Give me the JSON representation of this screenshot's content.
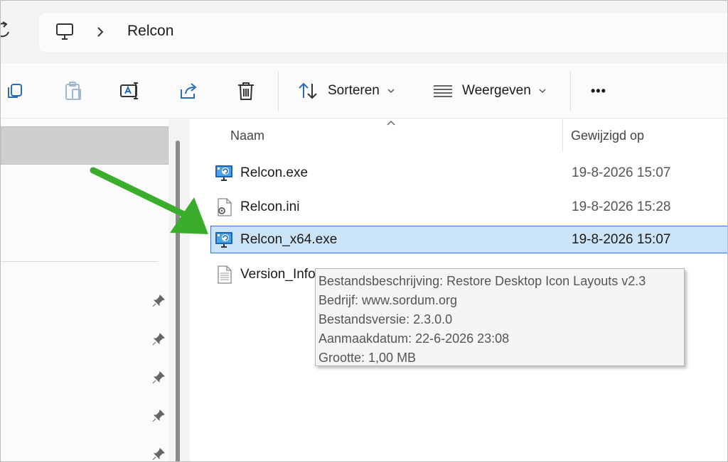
{
  "address_bar": {
    "breadcrumb": "Relcon",
    "icons": [
      "refresh-icon",
      "computer-icon",
      "chevron-right-icon"
    ]
  },
  "command_bar": {
    "sort_label": "Sorteren",
    "view_label": "Weergeven",
    "more_label": "•••",
    "icons": [
      "copy-icon",
      "paste-icon",
      "rename-icon",
      "share-icon",
      "delete-icon",
      "sort-icon",
      "view-icon",
      "chevron-down-icon"
    ]
  },
  "columns": {
    "name": "Naam",
    "modified": "Gewijzigd op"
  },
  "files": [
    {
      "name": "Relcon.exe",
      "modified": "19-8-2026 15:07",
      "icon": "application-icon",
      "selected": false
    },
    {
      "name": "Relcon.ini",
      "modified": "19-8-2026 15:28",
      "icon": "settings-file-icon",
      "selected": false
    },
    {
      "name": "Relcon_x64.exe",
      "modified": "19-8-2026 15:07",
      "icon": "application-icon",
      "selected": true
    },
    {
      "name": "Version_Info",
      "modified": "",
      "icon": "text-file-icon",
      "selected": false
    }
  ],
  "tooltip": {
    "lines": [
      "Bestandsbeschrijving: Restore Desktop Icon Layouts v2.3",
      "Bedrijf: www.sordum.org",
      "Bestandsversie: 2.3.0.0",
      "Aanmaakdatum: 22-6-2026 23:08",
      "Grootte: 1,00 MB"
    ]
  },
  "colors": {
    "selection_bg": "#cce4f7",
    "selection_border": "#3b76c5",
    "accent": "#2b6cb8",
    "annotation_arrow": "#3aad2c"
  }
}
